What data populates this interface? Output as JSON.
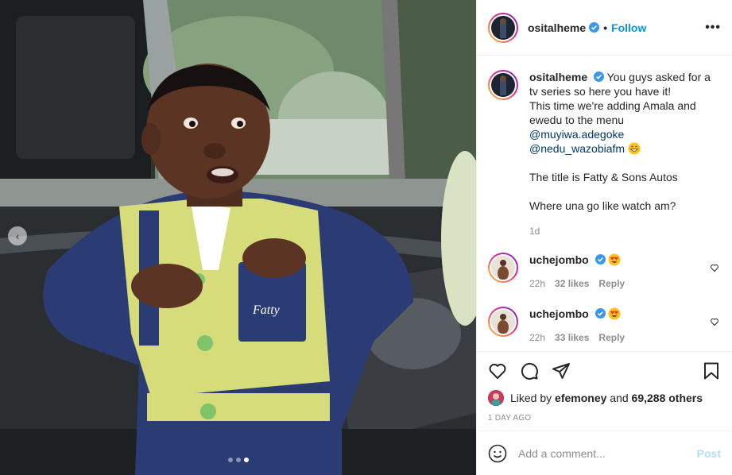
{
  "header": {
    "username": "ositalheme",
    "separator": "•",
    "follow_label": "Follow",
    "more_label": "•••"
  },
  "caption": {
    "username": "ositalheme",
    "line1": "You guys asked for a tv series so here you have it!",
    "line2": "This time we're adding Amala and ewedu to the menu",
    "mention1": "@muyiwa.adegoke",
    "mention2": "@nedu_wazobiafm",
    "line3": "The title is Fatty & Sons Autos",
    "line4": "Where una go like watch am?",
    "time": "1d"
  },
  "comments": [
    {
      "username": "uchejombo",
      "time": "22h",
      "likes": "32 likes",
      "reply": "Reply"
    },
    {
      "username": "uchejombo",
      "time": "22h",
      "likes": "33 likes",
      "reply": "Reply"
    }
  ],
  "likes": {
    "prefix": "Liked by",
    "user": "efemoney",
    "middle": "and",
    "others": "69,288 others"
  },
  "date": "1 DAY AGO",
  "add_comment": {
    "placeholder": "Add a comment...",
    "post_label": "Post"
  },
  "media": {
    "slide_count": 3,
    "active_slide": 3
  },
  "colors": {
    "accent": "#0095f6",
    "mention": "#00376b",
    "muted": "#8e8e8e",
    "post_disabled": "#b2dffc"
  },
  "icons": [
    "verified-icon",
    "more-icon",
    "heart-icon",
    "comment-icon",
    "share-icon",
    "bookmark-icon",
    "smiley-icon",
    "chevron-left-icon"
  ]
}
